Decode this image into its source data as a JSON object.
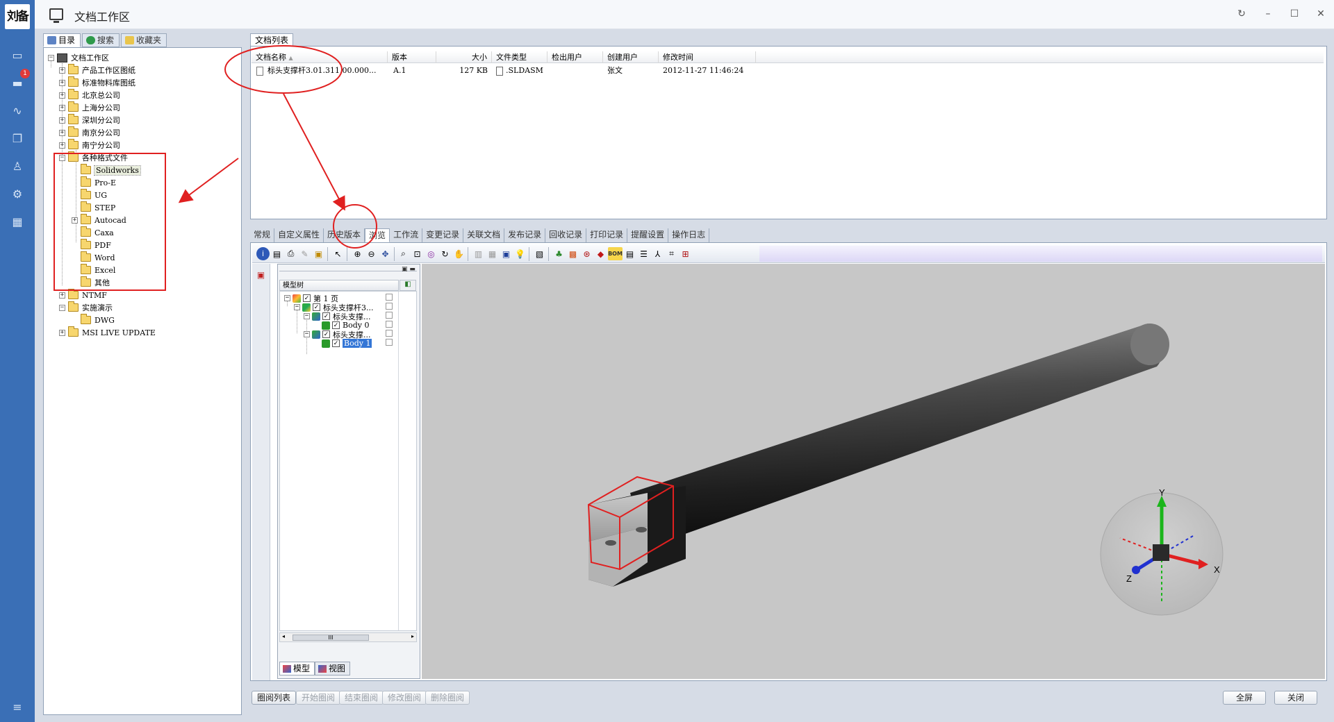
{
  "window": {
    "title": "文档工作区",
    "logo_text": "刘备"
  },
  "rail": {
    "notification_count": "1"
  },
  "left_tabs": [
    {
      "label": "目录"
    },
    {
      "label": "搜索"
    },
    {
      "label": "收藏夹"
    }
  ],
  "tree": {
    "root": "文档工作区",
    "folders": [
      "产品工作区图纸",
      "标准物料库图纸",
      "北京总公司",
      "上海分公司",
      "深圳分公司",
      "南京分公司",
      "南宁分公司",
      "各种格式文件"
    ],
    "format_folders": [
      "Solidworks",
      "Pro-E",
      "UG",
      "STEP",
      "Autocad",
      "Caxa",
      "PDF",
      "Word",
      "Excel",
      "其他"
    ],
    "after": [
      "NTMF",
      "实施演示",
      "DWG",
      "MSI LIVE UPDATE"
    ]
  },
  "doclist": {
    "tab": "文档列表",
    "columns": [
      "文档名称",
      "版本",
      "大小",
      "文件类型",
      "检出用户",
      "创建用户",
      "修改时间"
    ],
    "row": {
      "name": "标头支撑杆3.01.311.00.000...",
      "version": "A.1",
      "size": "127 KB",
      "type": ".SLDASM",
      "checkout_user": "",
      "creator": "张文",
      "modified": "2012-11-27 11:46:24"
    }
  },
  "detail_tabs": [
    "常规",
    "自定义属性",
    "历史版本",
    "浏览",
    "工作流",
    "变更记录",
    "关联文档",
    "发布记录",
    "回收记录",
    "打印记录",
    "提醒设置",
    "操作日志"
  ],
  "model_tree": {
    "header": "模型树",
    "nodes": [
      {
        "label": "第 1 页"
      },
      {
        "label": "标头支撑杆3..."
      },
      {
        "label": "标头支撑..."
      },
      {
        "label": "Body 0"
      },
      {
        "label": "标头支撑..."
      },
      {
        "label": "Body 1"
      }
    ],
    "tabs": [
      "模型",
      "视图"
    ],
    "scroll_label": "III"
  },
  "toolbar": {
    "bom_label": "BOM"
  },
  "axes": {
    "x": "X",
    "y": "Y",
    "z": "Z"
  },
  "bottom_buttons": [
    "圈阅列表",
    "开始圈阅",
    "结束圈阅",
    "修改圈阅",
    "删除圈阅"
  ],
  "right_buttons": [
    "全屏",
    "关闭"
  ],
  "colors": {
    "rail": "#3a6fb6",
    "annotation": "#e02020",
    "selection": "#3476d6"
  }
}
